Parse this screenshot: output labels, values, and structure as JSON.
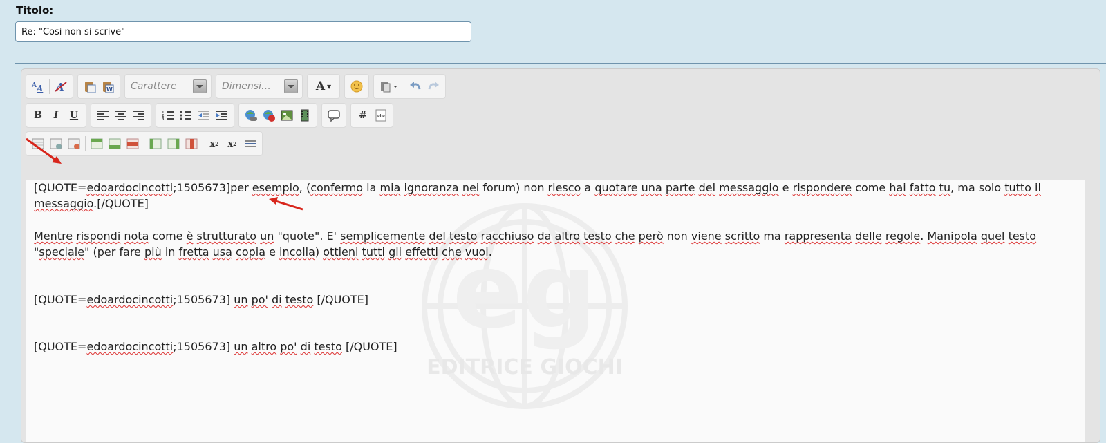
{
  "form": {
    "title_label": "Titolo:",
    "title_value": "Re: \"Cosi non si scrive\""
  },
  "toolbar": {
    "font_placeholder": "Carattere",
    "size_placeholder": "Dimensi…",
    "bold": "B",
    "italic": "I",
    "underline": "U",
    "hash": "#",
    "font_color": "A",
    "subscript": "x",
    "superscript": "x"
  },
  "watermark": {
    "brand": "EDITRICE GIOCHI"
  },
  "editor": {
    "p1": [
      {
        "t": "[QUOTE="
      },
      {
        "t": "edoardocincotti",
        "s": true
      },
      {
        "t": ";1505673]per "
      },
      {
        "t": "esempio",
        "s": true
      },
      {
        "t": ", ("
      },
      {
        "t": "confermo",
        "s": true
      },
      {
        "t": " la "
      },
      {
        "t": "mia",
        "s": true
      },
      {
        "t": " "
      },
      {
        "t": "ignoranza",
        "s": true
      },
      {
        "t": " "
      },
      {
        "t": "nei",
        "s": true
      },
      {
        "t": " forum) non "
      },
      {
        "t": "riesco",
        "s": true
      },
      {
        "t": " a "
      },
      {
        "t": "quotare",
        "s": true
      },
      {
        "t": " "
      },
      {
        "t": "una",
        "s": true
      },
      {
        "t": " "
      },
      {
        "t": "parte",
        "s": true
      },
      {
        "t": " "
      },
      {
        "t": "del",
        "s": true
      },
      {
        "t": " "
      },
      {
        "t": "messaggio",
        "s": true
      },
      {
        "t": " e "
      },
      {
        "t": "rispondere",
        "s": true
      },
      {
        "t": " come "
      },
      {
        "t": "hai",
        "s": true
      },
      {
        "t": " "
      },
      {
        "t": "fatto",
        "s": true
      },
      {
        "t": " "
      },
      {
        "t": "tu",
        "s": true
      },
      {
        "t": ", ma solo "
      },
      {
        "t": "tutto",
        "s": true
      },
      {
        "t": " "
      },
      {
        "t": "il",
        "s": true
      },
      {
        "t": " "
      },
      {
        "t": "messaggio",
        "s": true
      },
      {
        "t": ".[/QUOTE]"
      }
    ],
    "p2": [
      {
        "t": "Mentre",
        "s": true
      },
      {
        "t": " "
      },
      {
        "t": "rispondi",
        "s": true
      },
      {
        "t": " "
      },
      {
        "t": "nota",
        "s": true
      },
      {
        "t": " come "
      },
      {
        "t": "è",
        "s": true
      },
      {
        "t": " "
      },
      {
        "t": "strutturato",
        "s": true
      },
      {
        "t": " "
      },
      {
        "t": "un",
        "s": true
      },
      {
        "t": " \"quote\". E' "
      },
      {
        "t": "semplicemente",
        "s": true
      },
      {
        "t": " "
      },
      {
        "t": "del",
        "s": true
      },
      {
        "t": " "
      },
      {
        "t": "testo",
        "s": true
      },
      {
        "t": " "
      },
      {
        "t": "racchiuso",
        "s": true
      },
      {
        "t": " "
      },
      {
        "t": "da",
        "s": true
      },
      {
        "t": " "
      },
      {
        "t": "altro",
        "s": true
      },
      {
        "t": " "
      },
      {
        "t": "testo",
        "s": true
      },
      {
        "t": " "
      },
      {
        "t": "che",
        "s": true
      },
      {
        "t": " "
      },
      {
        "t": "però",
        "s": true
      },
      {
        "t": " non "
      },
      {
        "t": "viene",
        "s": true
      },
      {
        "t": " "
      },
      {
        "t": "scritto",
        "s": true
      },
      {
        "t": " ma "
      },
      {
        "t": "rappresenta",
        "s": true
      },
      {
        "t": " "
      },
      {
        "t": "delle",
        "s": true
      },
      {
        "t": " "
      },
      {
        "t": "regole",
        "s": true
      },
      {
        "t": ". "
      },
      {
        "t": "Manipola",
        "s": true
      },
      {
        "t": " "
      },
      {
        "t": "quel",
        "s": true
      },
      {
        "t": " "
      },
      {
        "t": "testo",
        "s": true
      },
      {
        "t": " \""
      },
      {
        "t": "speciale",
        "s": true
      },
      {
        "t": "\" (per fare "
      },
      {
        "t": "più",
        "s": true
      },
      {
        "t": " in "
      },
      {
        "t": "fretta",
        "s": true
      },
      {
        "t": " "
      },
      {
        "t": "usa",
        "s": true
      },
      {
        "t": " "
      },
      {
        "t": "copia",
        "s": true
      },
      {
        "t": " e "
      },
      {
        "t": "incolla",
        "s": true
      },
      {
        "t": ") "
      },
      {
        "t": "ottieni",
        "s": true
      },
      {
        "t": " "
      },
      {
        "t": "tutti",
        "s": true
      },
      {
        "t": " "
      },
      {
        "t": "gli",
        "s": true
      },
      {
        "t": " "
      },
      {
        "t": "effetti",
        "s": true
      },
      {
        "t": " "
      },
      {
        "t": "che",
        "s": true
      },
      {
        "t": " "
      },
      {
        "t": "vuoi",
        "s": true
      },
      {
        "t": "."
      }
    ],
    "p3": [
      {
        "t": "[QUOTE="
      },
      {
        "t": "edoardocincotti",
        "s": true
      },
      {
        "t": ";1505673] "
      },
      {
        "t": "un",
        "s": true
      },
      {
        "t": " "
      },
      {
        "t": "po'",
        "s": true
      },
      {
        "t": " "
      },
      {
        "t": "di",
        "s": true
      },
      {
        "t": " "
      },
      {
        "t": "testo",
        "s": true
      },
      {
        "t": " [/QUOTE]"
      }
    ],
    "p4": [
      {
        "t": "[QUOTE="
      },
      {
        "t": "edoardocincotti",
        "s": true
      },
      {
        "t": ";1505673] "
      },
      {
        "t": "un",
        "s": true
      },
      {
        "t": " "
      },
      {
        "t": "altro",
        "s": true
      },
      {
        "t": " "
      },
      {
        "t": "po'",
        "s": true
      },
      {
        "t": " "
      },
      {
        "t": "di",
        "s": true
      },
      {
        "t": " "
      },
      {
        "t": "testo",
        "s": true
      },
      {
        "t": " [/QUOTE]"
      }
    ]
  },
  "colors": {
    "background": "#d5e7ef",
    "accent": "#6f94ad",
    "annotation_arrow": "#d8261c",
    "spellcheck": "#d33"
  }
}
